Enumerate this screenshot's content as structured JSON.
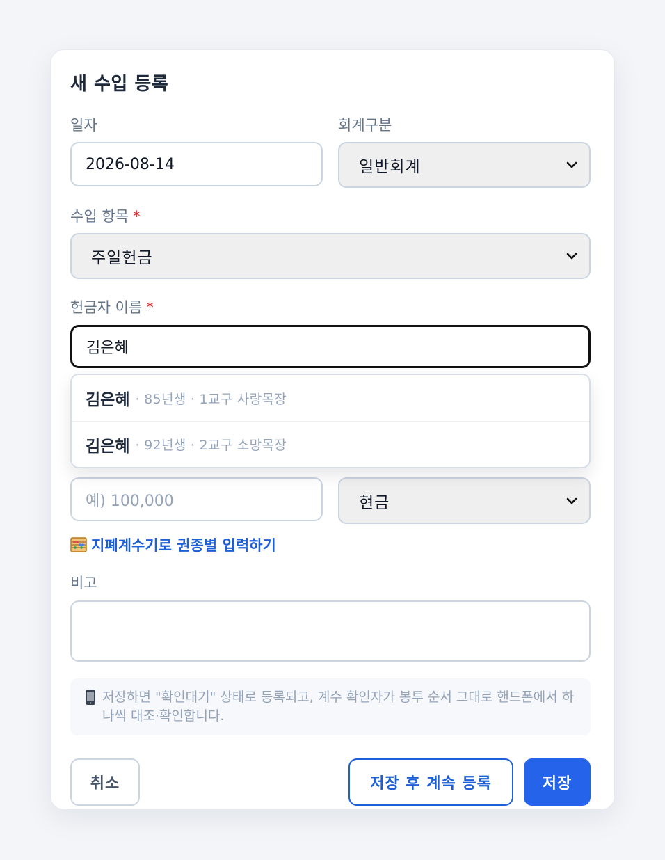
{
  "form": {
    "title": "새 수입 등록",
    "date": {
      "label": "일자",
      "value": "2026-08-14"
    },
    "account": {
      "label": "회계구분",
      "selected": "일반회계"
    },
    "income_item": {
      "label": "수입 항목",
      "required_mark": "*",
      "selected": "주일헌금"
    },
    "donor": {
      "label": "헌금자 이름",
      "required_mark": "*",
      "value": "김은혜"
    },
    "suggestions": [
      {
        "name": "김은혜",
        "meta": "· 85년생 · 1교구 사랑목장"
      },
      {
        "name": "김은혜",
        "meta": "· 92년생 · 2교구 소망목장"
      }
    ],
    "amount": {
      "placeholder": "예) 100,000"
    },
    "method": {
      "selected": "현금"
    },
    "counter_link": {
      "label": "지폐계수기로 권종별 입력하기",
      "icon": "abacus-icon"
    },
    "memo": {
      "label": "비고",
      "value": ""
    },
    "notice": {
      "icon": "mobile-phone-icon",
      "text": "저장하면 \"확인대기\" 상태로 등록되고, 계수 확인자가 봉투 순서 그대로 핸드폰에서 하나씩 대조·확인합니다."
    },
    "buttons": {
      "cancel": "취소",
      "save_continue": "저장 후 계속 등록",
      "save": "저장"
    }
  },
  "colors": {
    "accent": "#2563eb",
    "link": "#1d5fd6",
    "required": "#dc2626",
    "page_bg": "#f3f5f9"
  }
}
